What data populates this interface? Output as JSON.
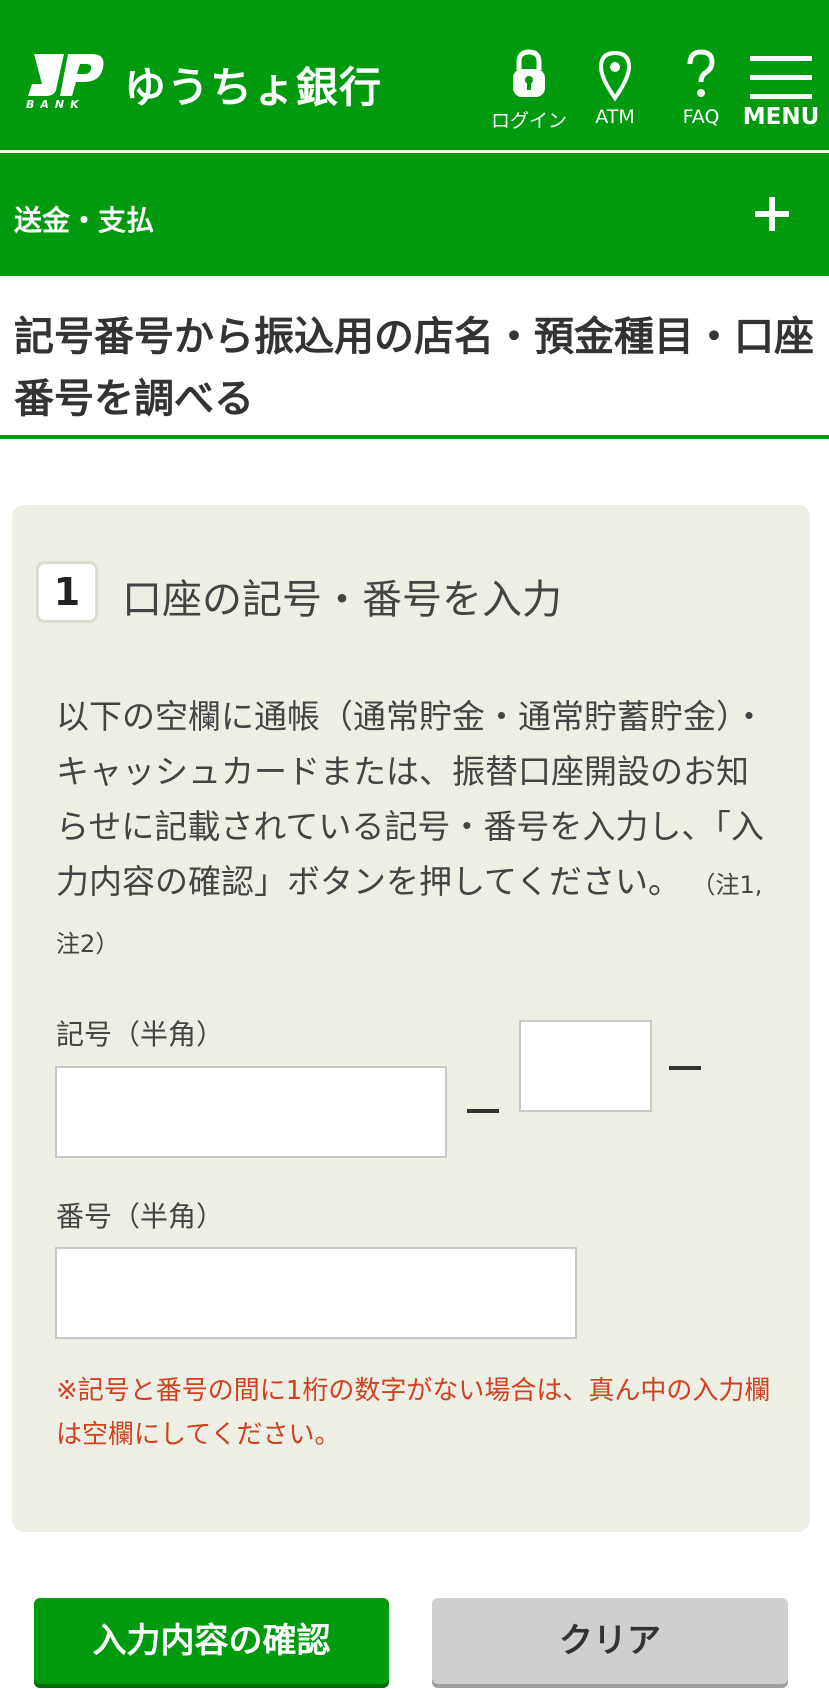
{
  "header": {
    "logo_sub": "BANK",
    "brand": "ゆうちょ銀行",
    "nav": [
      {
        "label": "ログイン",
        "icon": "lock-icon"
      },
      {
        "label": "ATM",
        "icon": "location-pin-icon"
      },
      {
        "label": "FAQ",
        "icon": "question-icon"
      },
      {
        "label": "MENU",
        "icon": "hamburger-menu-icon"
      }
    ]
  },
  "subnav": {
    "label": "送金・支払",
    "icon": "plus-icon"
  },
  "page": {
    "title": "記号番号から振込用の店名・預金種目・口座番号を調べる"
  },
  "step": {
    "number": "1",
    "title": "口座の記号・番号を入力",
    "description": "以下の空欄に通帳（通常貯金・通常貯蓄貯金）・キャッシュカードまたは、振替口座開設のお知らせに記載されている記号・番号を入力し、「入力内容の確認」ボタンを押してください。",
    "note": "（注1, 注2）"
  },
  "form": {
    "kigou_label": "記号（半角）",
    "kigou_value": "",
    "middle_value": "",
    "bangou_label": "番号（半角）",
    "bangou_value": "",
    "warning": "※記号と番号の間に1桁の数字がない場合は、真ん中の入力欄は空欄にしてください。"
  },
  "buttons": {
    "confirm": "入力内容の確認",
    "clear": "クリア"
  },
  "colors": {
    "brand_green": "#009a0e",
    "panel_bg": "#eeefe4",
    "warning_red": "#d2401f"
  }
}
